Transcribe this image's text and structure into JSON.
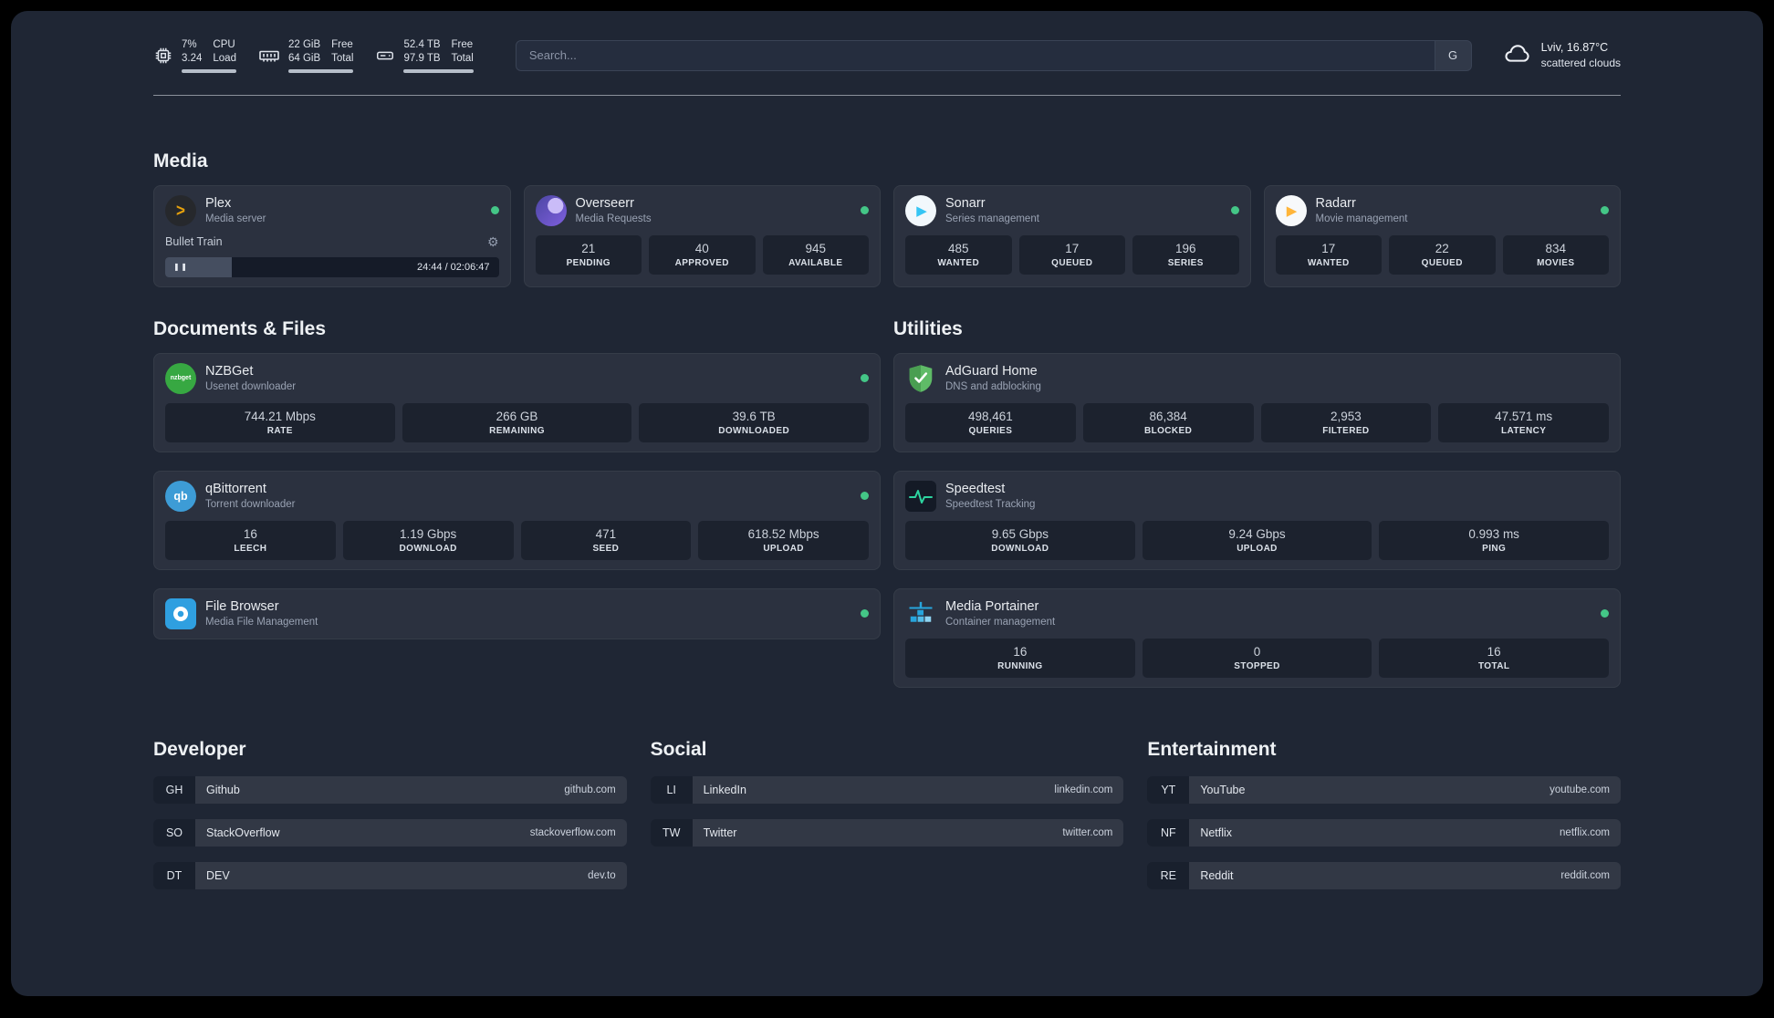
{
  "topbar": {
    "cpu": {
      "value_top": "7%",
      "value_bottom": "3.24",
      "label_top": "CPU",
      "label_bottom": "Load"
    },
    "memory": {
      "value_top": "22 GiB",
      "value_bottom": "64 GiB",
      "label_top": "Free",
      "label_bottom": "Total"
    },
    "disk": {
      "value_top": "52.4 TB",
      "value_bottom": "97.9 TB",
      "label_top": "Free",
      "label_bottom": "Total"
    },
    "search": {
      "placeholder": "Search...",
      "provider_label": "G"
    },
    "weather": {
      "location": "Lviv, 16.87°C",
      "condition": "scattered clouds"
    }
  },
  "media": {
    "title": "Media",
    "plex": {
      "name": "Plex",
      "desc": "Media server",
      "now_playing": {
        "title": "Bullet Train",
        "time": "24:44 / 02:06:47",
        "progress_percent": 20
      }
    },
    "overseerr": {
      "name": "Overseerr",
      "desc": "Media Requests",
      "stats": [
        {
          "value": "21",
          "label": "PENDING"
        },
        {
          "value": "40",
          "label": "APPROVED"
        },
        {
          "value": "945",
          "label": "AVAILABLE"
        }
      ]
    },
    "sonarr": {
      "name": "Sonarr",
      "desc": "Series management",
      "stats": [
        {
          "value": "485",
          "label": "WANTED"
        },
        {
          "value": "17",
          "label": "QUEUED"
        },
        {
          "value": "196",
          "label": "SERIES"
        }
      ]
    },
    "radarr": {
      "name": "Radarr",
      "desc": "Movie management",
      "stats": [
        {
          "value": "17",
          "label": "WANTED"
        },
        {
          "value": "22",
          "label": "QUEUED"
        },
        {
          "value": "834",
          "label": "MOVIES"
        }
      ]
    }
  },
  "documents": {
    "title": "Documents & Files",
    "nzbget": {
      "name": "NZBGet",
      "desc": "Usenet downloader",
      "stats": [
        {
          "value": "744.21 Mbps",
          "label": "RATE"
        },
        {
          "value": "266 GB",
          "label": "REMAINING"
        },
        {
          "value": "39.6 TB",
          "label": "DOWNLOADED"
        }
      ]
    },
    "qbittorrent": {
      "name": "qBittorrent",
      "desc": "Torrent downloader",
      "stats": [
        {
          "value": "16",
          "label": "LEECH"
        },
        {
          "value": "1.19 Gbps",
          "label": "DOWNLOAD"
        },
        {
          "value": "471",
          "label": "SEED"
        },
        {
          "value": "618.52 Mbps",
          "label": "UPLOAD"
        }
      ]
    },
    "filebrowser": {
      "name": "File Browser",
      "desc": "Media File Management"
    }
  },
  "utilities": {
    "title": "Utilities",
    "adguard": {
      "name": "AdGuard Home",
      "desc": "DNS and adblocking",
      "stats": [
        {
          "value": "498,461",
          "label": "QUERIES"
        },
        {
          "value": "86,384",
          "label": "BLOCKED"
        },
        {
          "value": "2,953",
          "label": "FILTERED"
        },
        {
          "value": "47.571 ms",
          "label": "LATENCY"
        }
      ]
    },
    "speedtest": {
      "name": "Speedtest",
      "desc": "Speedtest Tracking",
      "stats": [
        {
          "value": "9.65 Gbps",
          "label": "DOWNLOAD"
        },
        {
          "value": "9.24 Gbps",
          "label": "UPLOAD"
        },
        {
          "value": "0.993 ms",
          "label": "PING"
        }
      ]
    },
    "portainer": {
      "name": "Media Portainer",
      "desc": "Container management",
      "stats": [
        {
          "value": "16",
          "label": "RUNNING"
        },
        {
          "value": "0",
          "label": "STOPPED"
        },
        {
          "value": "16",
          "label": "TOTAL"
        }
      ]
    }
  },
  "bookmarks": {
    "developer": {
      "title": "Developer",
      "items": [
        {
          "abbr": "GH",
          "name": "Github",
          "url": "github.com"
        },
        {
          "abbr": "SO",
          "name": "StackOverflow",
          "url": "stackoverflow.com"
        },
        {
          "abbr": "DT",
          "name": "DEV",
          "url": "dev.to"
        }
      ]
    },
    "social": {
      "title": "Social",
      "items": [
        {
          "abbr": "LI",
          "name": "LinkedIn",
          "url": "linkedin.com"
        },
        {
          "abbr": "TW",
          "name": "Twitter",
          "url": "twitter.com"
        }
      ]
    },
    "entertainment": {
      "title": "Entertainment",
      "items": [
        {
          "abbr": "YT",
          "name": "YouTube",
          "url": "youtube.com"
        },
        {
          "abbr": "NF",
          "name": "Netflix",
          "url": "netflix.com"
        },
        {
          "abbr": "RE",
          "name": "Reddit",
          "url": "reddit.com"
        }
      ]
    }
  },
  "icons": {
    "plex_glyph": ">",
    "pause_glyph": "❚❚",
    "gear_glyph": "⚙",
    "nzbget_text": "nzbget",
    "qbittorrent_text": "qb",
    "sonarr_glyph": "▶",
    "radarr_glyph": "▶"
  },
  "colors": {
    "background": "#1f2634",
    "status_green": "#44c687",
    "plex_accent": "#e5a00d",
    "sonarr_accent": "#35c5f4",
    "radarr_accent": "#ffb53a",
    "nzbget_accent": "#37a842",
    "qbittorrent_accent": "#3d9cd6",
    "filebrowser_accent": "#2f9fe0",
    "adguard_accent": "#5fbb67",
    "speedtest_accent": "#2dd4a0",
    "portainer_accent": "#27a5dc"
  }
}
